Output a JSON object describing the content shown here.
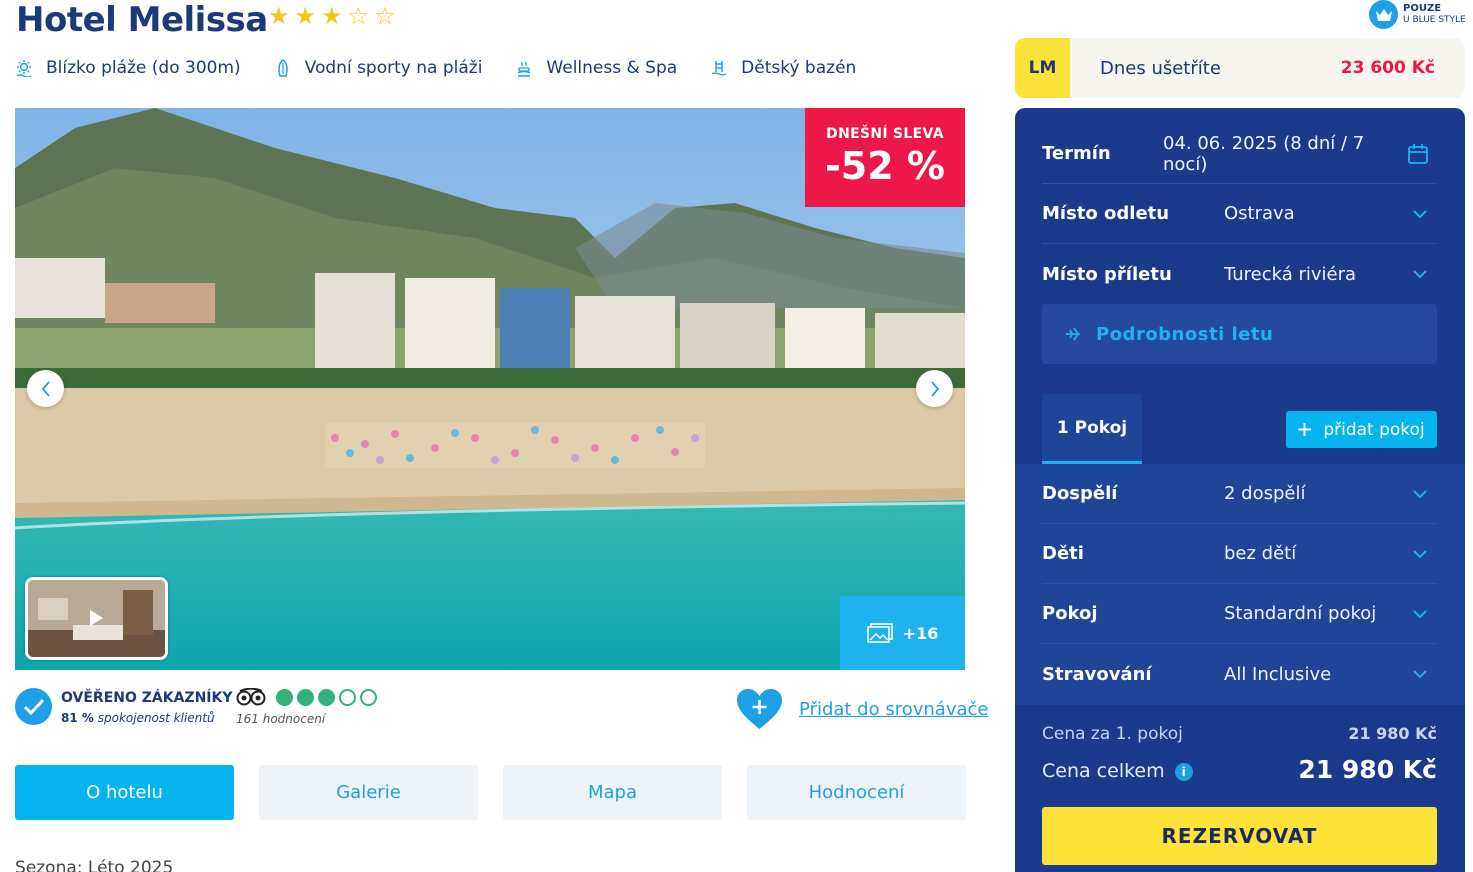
{
  "hotel": {
    "name": "Hotel Melissa",
    "stars": 3,
    "max_stars": 5,
    "features": [
      {
        "icon": "sun-beach-icon",
        "label": "Blízko pláže (do 300m)"
      },
      {
        "icon": "surfboard-icon",
        "label": "Vodní sporty na pláži"
      },
      {
        "icon": "spa-icon",
        "label": "Wellness & Spa"
      },
      {
        "icon": "pool-ladder-icon",
        "label": "Dětský bazén"
      }
    ]
  },
  "gallery": {
    "discount_label": "DNEŠNÍ SLEVA",
    "discount_value": "-52 %",
    "more_photos": "+16"
  },
  "reviews": {
    "verified_title": "OVĚŘENO ZÁKAZNÍKY",
    "satisfaction_value": "81 %",
    "satisfaction_text": "spokojenost klientů",
    "tripadvisor_score": 3,
    "tripadvisor_max": 5,
    "tripadvisor_count": "161 hodnocení",
    "compare_link": "Přidat do srovnávače"
  },
  "tabs": [
    {
      "label": "O hotelu",
      "active": true
    },
    {
      "label": "Galerie",
      "active": false
    },
    {
      "label": "Mapa",
      "active": false
    },
    {
      "label": "Hodnocení",
      "active": false
    }
  ],
  "season": "Sezona: Léto 2025",
  "badge": {
    "line1": "POUZE",
    "line2": "U BLUE STYLE"
  },
  "lastminute": {
    "tag": "LM",
    "text": "Dnes ušetříte",
    "amount": "23 600 Kč"
  },
  "booking": {
    "term_label": "Termín",
    "term_value": "04. 06. 2025 (8 dní / 7 nocí)",
    "departure_label": "Místo odletu",
    "departure_value": "Ostrava",
    "arrival_label": "Místo příletu",
    "arrival_value": "Turecká riviéra",
    "flight_details": "Podrobnosti letu",
    "room_tab": "1 Pokoj",
    "add_room": "přidat pokoj",
    "adults_label": "Dospělí",
    "adults_value": "2 dospělí",
    "children_label": "Děti",
    "children_value": "bez dětí",
    "room_label": "Pokoj",
    "room_value": "Standardní pokoj",
    "board_label": "Stravování",
    "board_value": "All Inclusive",
    "price_room_label": "Cena za 1. pokoj",
    "price_room_value": "21 980 Kč",
    "price_total_label": "Cena celkem",
    "price_total_value": "21 980 Kč",
    "book_button": "REZERVOVAT"
  },
  "colors": {
    "brand_blue": "#1a3b8c",
    "accent_cyan": "#05b4ef",
    "discount_red": "#ee1848",
    "cta_yellow": "#fde23a",
    "tripadvisor_green": "#34b27b"
  }
}
